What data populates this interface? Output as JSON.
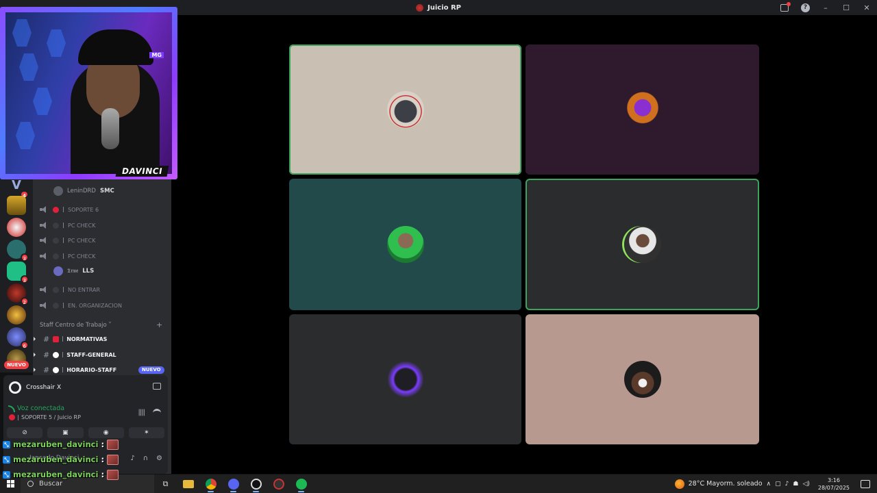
{
  "window": {
    "title": "Juicio RP"
  },
  "stream_overlay": {
    "streamer_label": "DAVINCI"
  },
  "voice_channels": [
    {
      "name": "SOPORTE 6",
      "status": "red"
    },
    {
      "name": "PC CHECK",
      "status": "idle"
    },
    {
      "name": "PC CHECK",
      "status": "idle"
    },
    {
      "name": "PC CHECK",
      "status": "idle"
    },
    {
      "name": "NO ENTRAR",
      "status": "idle"
    },
    {
      "name": "EN. ORGANIZACION",
      "status": "idle"
    }
  ],
  "members": [
    {
      "name": "LeninDRD",
      "tag": "SMC"
    },
    {
      "name": "𝕿𝖗𝖚𝖊",
      "tag": "LLS"
    }
  ],
  "category": {
    "name": "Staff Centro de Trabajo"
  },
  "text_channels": [
    {
      "name": "NORMATIVAS",
      "icon": "red-square-icon"
    },
    {
      "name": "STAFF-GENERAL",
      "icon": "speech-bubble-icon"
    },
    {
      "name": "HORARIO-STAFF",
      "icon": "clock-icon",
      "badge": "NUEVO"
    }
  ],
  "server_rail": {
    "badges": [
      "4",
      "3",
      "3",
      "2",
      "6"
    ],
    "new_label": "NUEVO"
  },
  "activity": {
    "app_name": "Crosshair X"
  },
  "voice_status": {
    "status": "Voz conectada",
    "location": "SOPORTE 5 / Juicio RP"
  },
  "user_panel": {
    "username": "Jancarlo Davinci"
  },
  "chat_overlay": [
    {
      "user": "mezaruben_davinci",
      "sep": ":"
    },
    {
      "user": "mezaruben_davinci",
      "sep": ":"
    },
    {
      "user": "mezaruben_davinci",
      "sep": ":"
    }
  ],
  "tiles": [
    {
      "bg": "#c9bfb3",
      "speaking": true,
      "avatar": "angry-fist-avatar"
    },
    {
      "bg": "#2e1a2c",
      "speaking": false,
      "avatar": "purple-character-avatar"
    },
    {
      "bg": "#224a4a",
      "speaking": false,
      "avatar": "sunglasses-man-avatar"
    },
    {
      "bg": "#2b2c2e",
      "speaking": true,
      "avatar": "portrait-man-avatar"
    },
    {
      "bg": "#2b2c2e",
      "speaking": false,
      "avatar": "purple-glow-avatar"
    },
    {
      "bg": "#b7998f",
      "speaking": false,
      "avatar": "cartoon-face-avatar"
    }
  ],
  "taskbar": {
    "search_placeholder": "Buscar",
    "weather": "28°C  Mayorm. soleado",
    "time": "3:16",
    "date": "28/07/2025"
  },
  "colors": {
    "speaking_outline": "#3ba55c",
    "accent": "#5865f2",
    "danger": "#f23f43"
  }
}
